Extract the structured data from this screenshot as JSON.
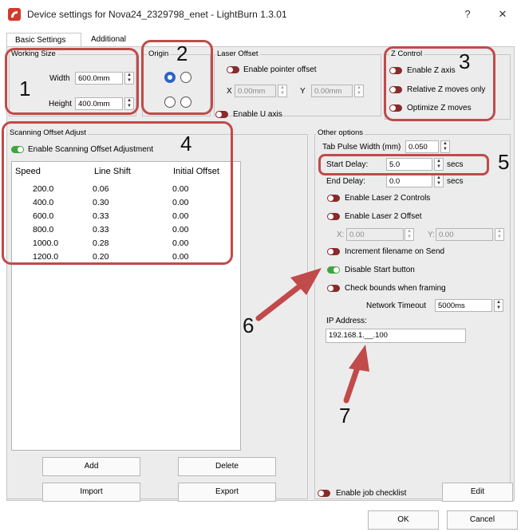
{
  "window": {
    "title": "Device settings for Nova24_2329798_enet - LightBurn 1.3.01",
    "help_button": "?",
    "close_button": "✕"
  },
  "tabs": [
    {
      "label": "Basic Settings"
    },
    {
      "label": "Additional Settings"
    }
  ],
  "working_size": {
    "title": "Working Size",
    "width_label": "Width",
    "width_value": "600.0mm",
    "height_label": "Height",
    "height_value": "400.0mm"
  },
  "origin": {
    "title": "Origin"
  },
  "laser_offset": {
    "title": "Laser Offset",
    "enable_pointer_label": "Enable pointer offset",
    "x_label": "X",
    "x_value": "0.00mm",
    "y_label": "Y",
    "y_value": "0.00mm",
    "enable_u_label": "Enable U axis"
  },
  "z_control": {
    "title": "Z Control",
    "enable_z_label": "Enable Z axis",
    "relative_z_label": "Relative Z moves only",
    "optimize_z_label": "Optimize Z moves"
  },
  "scanning": {
    "title": "Scanning Offset Adjust",
    "enable_label": "Enable Scanning Offset Adjustment",
    "columns": [
      "Speed",
      "Line Shift",
      "Initial Offset"
    ],
    "rows": [
      [
        "200.0",
        "0.06",
        "0.00"
      ],
      [
        "400.0",
        "0.30",
        "0.00"
      ],
      [
        "600.0",
        "0.33",
        "0.00"
      ],
      [
        "800.0",
        "0.33",
        "0.00"
      ],
      [
        "1000.0",
        "0.28",
        "0.00"
      ],
      [
        "1200.0",
        "0.20",
        "0.00"
      ]
    ],
    "add_label": "Add",
    "delete_label": "Delete",
    "import_label": "Import",
    "export_label": "Export"
  },
  "other": {
    "title": "Other options",
    "tab_pulse_label": "Tab Pulse Width (mm)",
    "tab_pulse_value": "0.050",
    "start_delay_label": "Start Delay:",
    "start_delay_value": "5.0",
    "start_delay_unit": "secs",
    "end_delay_label": "End Delay:",
    "end_delay_value": "0.0",
    "end_delay_unit": "secs",
    "laser2_controls_label": "Enable Laser 2 Controls",
    "laser2_offset_label": "Enable Laser 2 Offset",
    "l2_x_label": "X:",
    "l2_x_value": "0.00",
    "l2_y_label": "Y:",
    "l2_y_value": "0.00",
    "increment_label": "Increment filename on Send",
    "disable_start_label": "Disable Start button",
    "check_bounds_label": "Check bounds when framing",
    "network_timeout_label": "Network Timeout",
    "network_timeout_value": "5000ms",
    "ip_label": "IP Address:",
    "ip_value": "192.168.1.__.100"
  },
  "footer": {
    "job_checklist_label": "Enable job checklist",
    "edit_label": "Edit",
    "ok_label": "OK",
    "cancel_label": "Cancel"
  },
  "annotations": {
    "numbers": [
      "1",
      "2",
      "3",
      "4",
      "5",
      "6",
      "7"
    ],
    "color": "#c14a4a"
  },
  "colors": {
    "toggle_off": "#8a2a2a",
    "toggle_on": "#3fa53f",
    "radio_selected": "#2f63c4"
  }
}
